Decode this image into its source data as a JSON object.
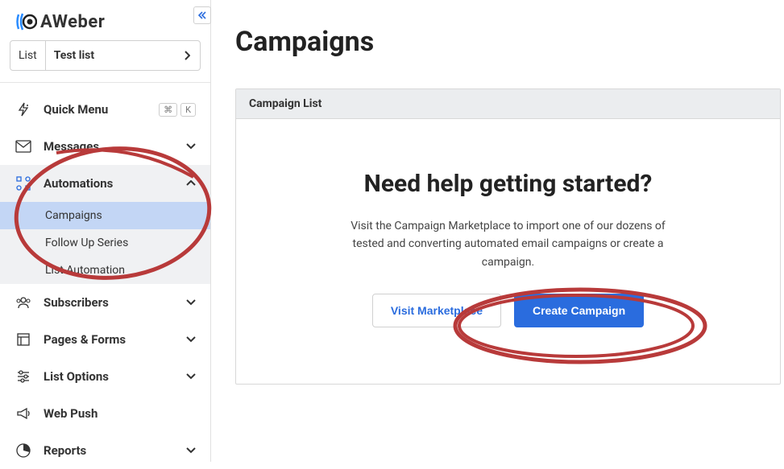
{
  "logo": {
    "text": "AWeber"
  },
  "listSelector": {
    "label": "List",
    "value": "Test list"
  },
  "quickMenu": {
    "label": "Quick Menu",
    "kbd1": "⌘",
    "kbd2": "K"
  },
  "nav": {
    "messages": "Messages",
    "automations": "Automations",
    "subscribers": "Subscribers",
    "pagesForms": "Pages & Forms",
    "listOptions": "List Options",
    "webPush": "Web Push",
    "reports": "Reports"
  },
  "automationsSub": {
    "campaigns": "Campaigns",
    "followUp": "Follow Up Series",
    "listAuto": "List Automation"
  },
  "page": {
    "title": "Campaigns",
    "panelHeader": "Campaign List",
    "heroTitle": "Need help getting started?",
    "heroDesc": "Visit the Campaign Marketplace to import one of our dozens of tested and converting automated email campaigns or create a campaign.",
    "btnSecondary": "Visit Marketplace",
    "btnPrimary": "Create Campaign"
  }
}
